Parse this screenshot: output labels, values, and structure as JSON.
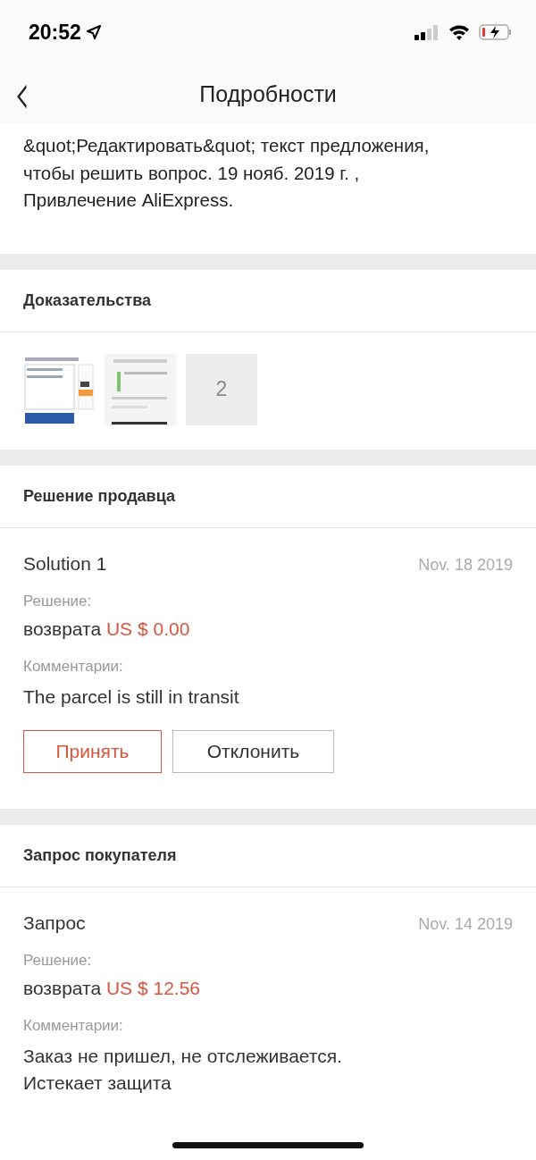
{
  "status_bar": {
    "time": "20:52"
  },
  "header": {
    "title": "Подробности",
    "back": "‹"
  },
  "description": {
    "lines": [
      "&quot;Редактировать&quot; текст предложения,",
      "чтобы решить вопрос. 19 нояб. 2019 г. ,",
      "Привлечение AliExpress."
    ]
  },
  "evidence": {
    "title": "Доказательства",
    "more_count": "2"
  },
  "seller_solution": {
    "title": "Решение продавца",
    "name": "Solution 1",
    "date": "Nov. 18 2019",
    "decision_label": "Решение:",
    "decision": "возврата",
    "amount": "US $ 0.00",
    "comment_label": "Комментарии:",
    "comment": "The parcel is still in transit",
    "buttons": [
      {
        "label": "Принять",
        "kind": "primary"
      },
      {
        "label": "Отклонить",
        "kind": "secondary"
      }
    ]
  },
  "buyer_request": {
    "title": "Запрос покупателя",
    "name": "Запрос",
    "date": "Nov. 14 2019",
    "decision_label": "Решение:",
    "decision": "возврата",
    "amount": "US $ 12.56",
    "comment_label": "Комментарии:",
    "comment": "Заказ не пришел, не отслеживается. Истекает защита"
  }
}
